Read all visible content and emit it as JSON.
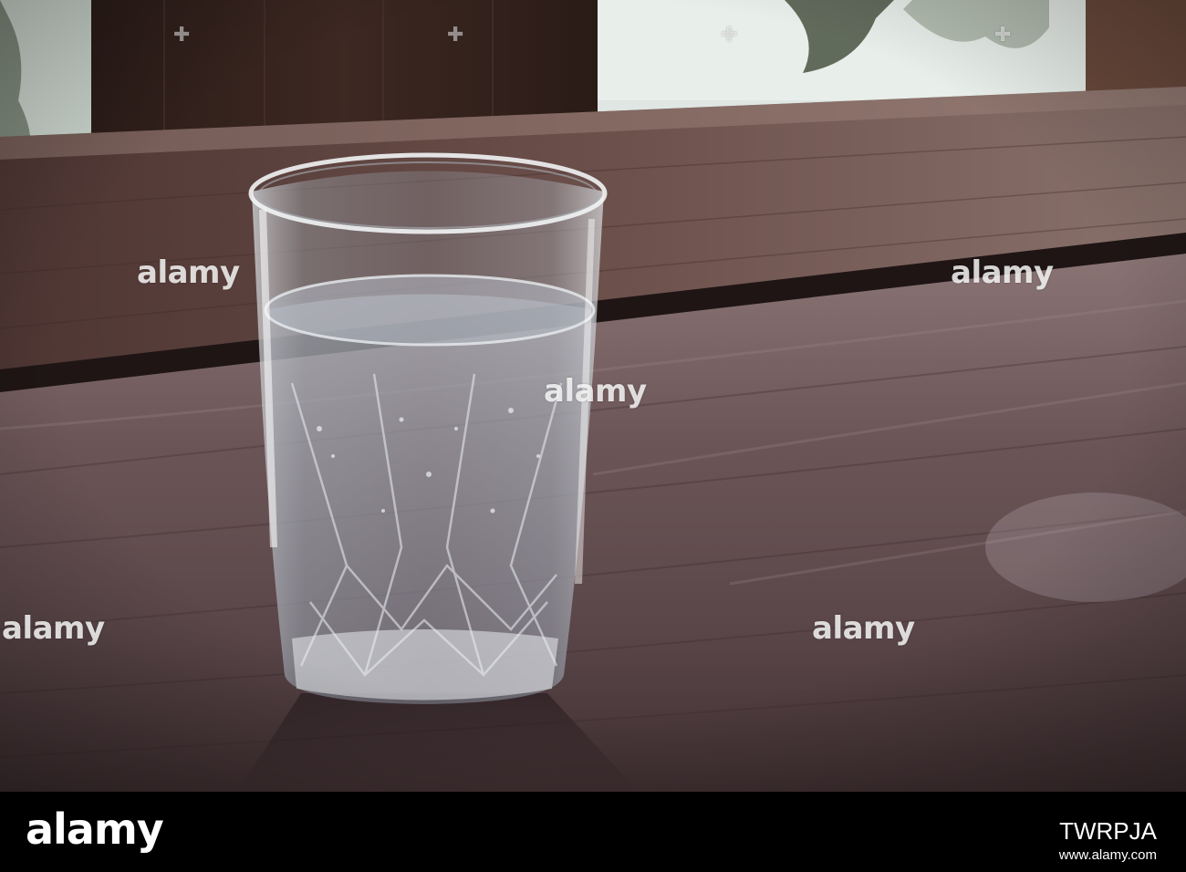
{
  "watermark": {
    "text": "alamy"
  },
  "footer": {
    "logo": "alamy",
    "image_id": "TWRPJA",
    "url": "www.alamy.com"
  },
  "colors": {
    "wood_dark": "#3b2a2a",
    "wood_mid": "#6e5656",
    "background_light": "#e6ecea",
    "footer_bg": "#000000"
  }
}
